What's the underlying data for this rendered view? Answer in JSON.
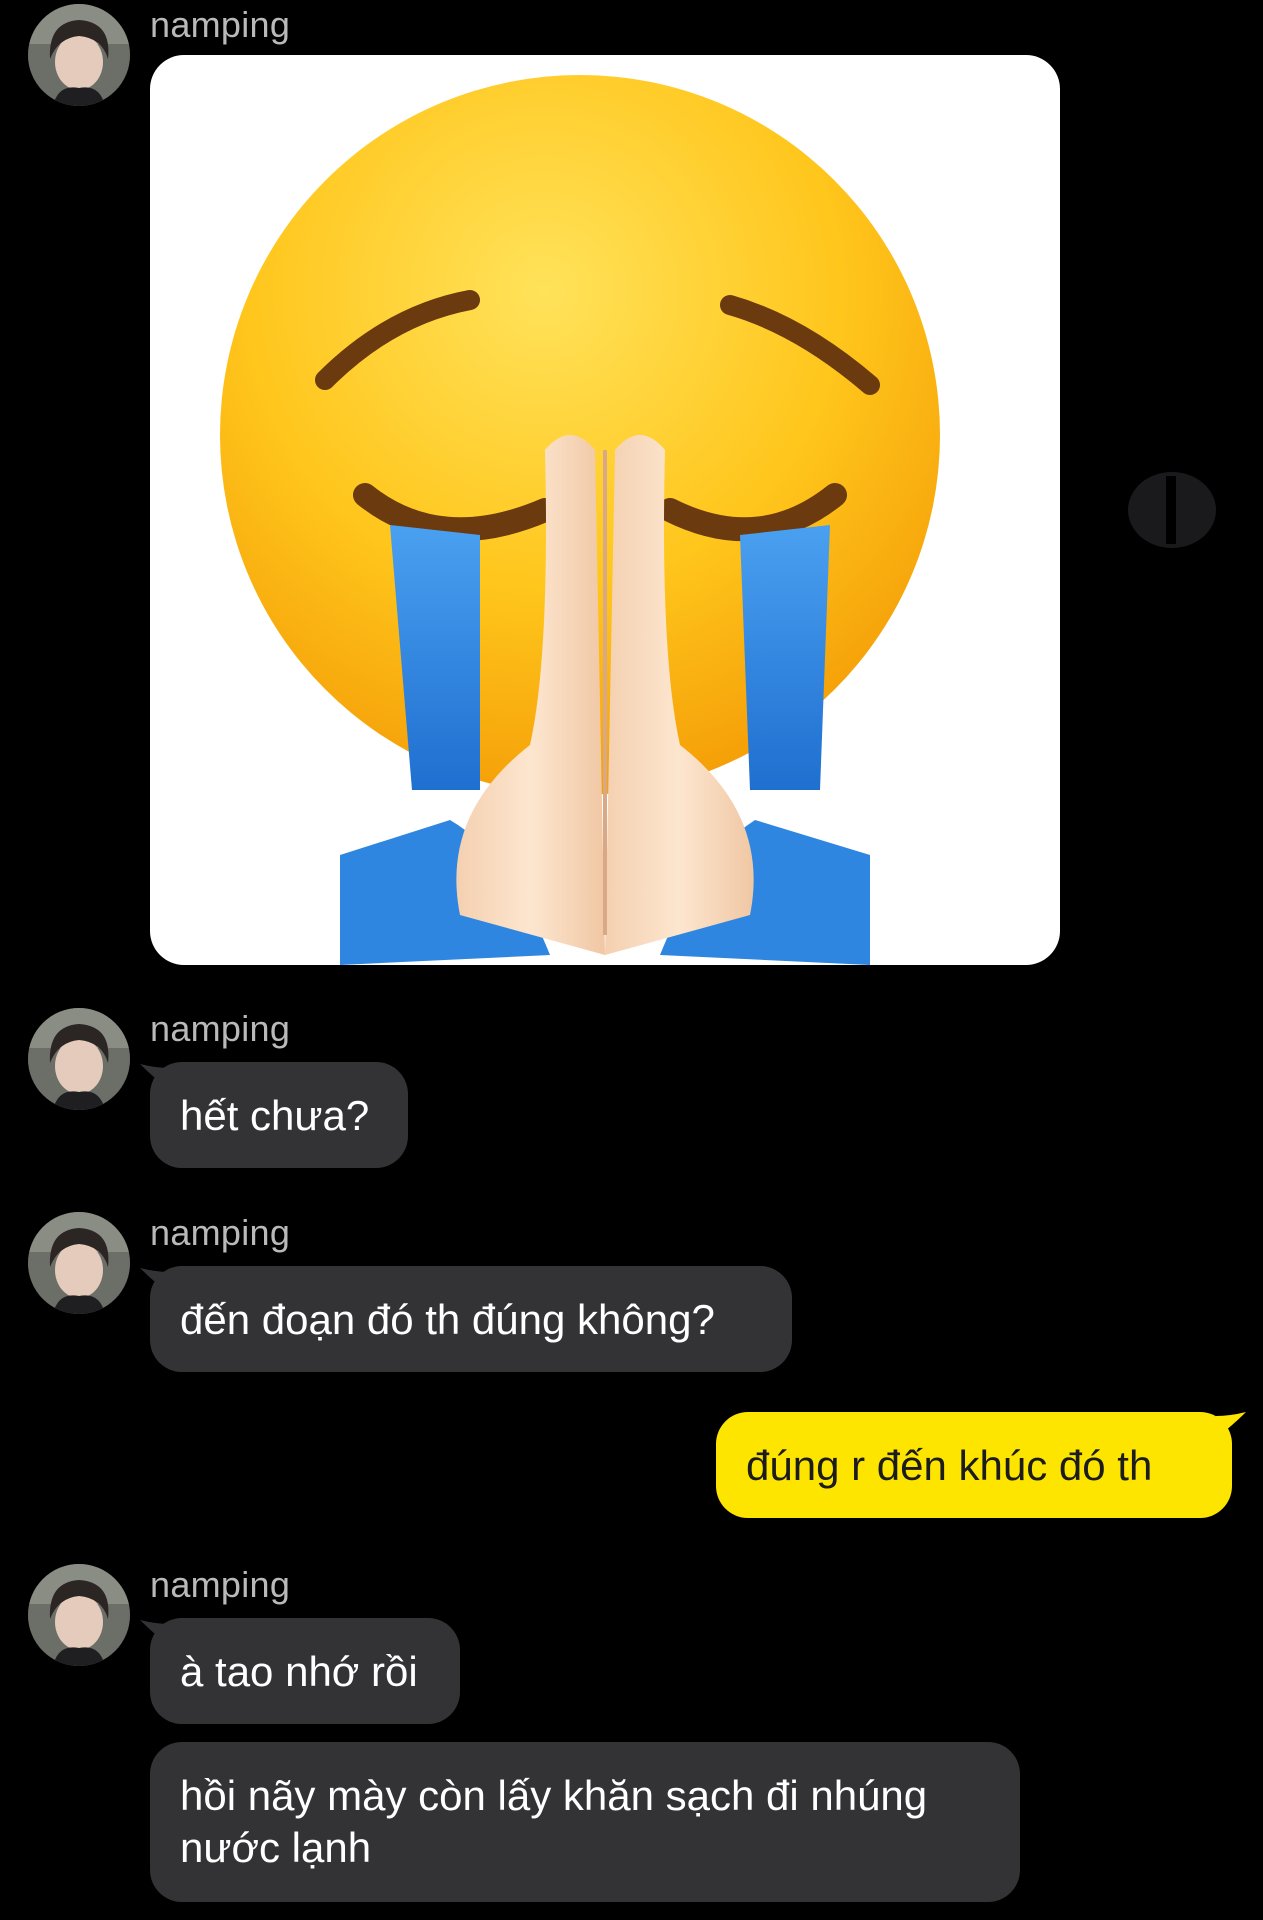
{
  "chat": {
    "messages": [
      {
        "sender": "namping",
        "type": "image",
        "image_icon": "pleading-crying-praying-emoji"
      },
      {
        "sender": "namping",
        "text": "hết chưa?"
      },
      {
        "sender": "namping",
        "text": "đến đoạn đó th đúng không?"
      },
      {
        "sender": "me",
        "text": "đúng r đến khúc đó th"
      },
      {
        "sender": "namping",
        "text": "à tao nhớ rồi"
      },
      {
        "sender": "",
        "text_line1": "hồi nãy mày còn lấy khăn sạch đi nhúng",
        "text_line2": "nước lạnh"
      }
    ]
  },
  "colors": {
    "background": "#000000",
    "incoming_bubble": "#333335",
    "outgoing_bubble": "#fee500",
    "sender_name": "#b9b9b9"
  }
}
